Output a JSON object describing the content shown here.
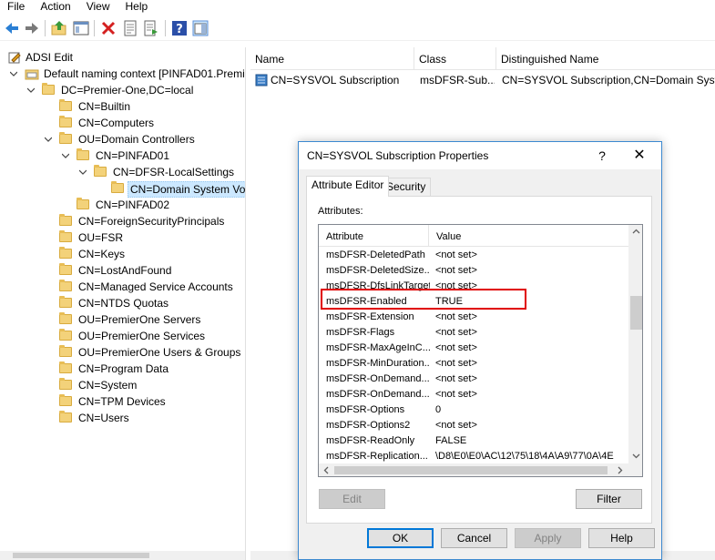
{
  "menu": {
    "items": [
      {
        "label": "File"
      },
      {
        "label": "Action"
      },
      {
        "label": "View"
      },
      {
        "label": "Help"
      }
    ]
  },
  "tree": {
    "root": "ADSI Edit",
    "nodes": [
      {
        "label": "Default naming context [PINFAD01.Premi"
      },
      {
        "label": "DC=Premier-One,DC=local"
      },
      {
        "label": "CN=Builtin"
      },
      {
        "label": "CN=Computers"
      },
      {
        "label": "OU=Domain Controllers"
      },
      {
        "label": "CN=PINFAD01"
      },
      {
        "label": "CN=DFSR-LocalSettings"
      },
      {
        "label": "CN=Domain System Vo"
      },
      {
        "label": "CN=PINFAD02"
      },
      {
        "label": "CN=ForeignSecurityPrincipals"
      },
      {
        "label": "OU=FSR"
      },
      {
        "label": "CN=Keys"
      },
      {
        "label": "CN=LostAndFound"
      },
      {
        "label": "CN=Managed Service Accounts"
      },
      {
        "label": "CN=NTDS Quotas"
      },
      {
        "label": "OU=PremierOne Servers"
      },
      {
        "label": "OU=PremierOne Services"
      },
      {
        "label": "OU=PremierOne Users & Groups"
      },
      {
        "label": "CN=Program Data"
      },
      {
        "label": "CN=System"
      },
      {
        "label": "CN=TPM Devices"
      },
      {
        "label": "CN=Users"
      }
    ]
  },
  "list": {
    "columns": {
      "name": "Name",
      "class": "Class",
      "dn": "Distinguished Name"
    },
    "rows": [
      {
        "name": "CN=SYSVOL Subscription",
        "class": "msDFSR-Sub...",
        "dn": "CN=SYSVOL Subscription,CN=Domain Syste"
      }
    ]
  },
  "dialog": {
    "title": "CN=SYSVOL Subscription Properties",
    "help_glyph": "?",
    "close_glyph": "✕",
    "tabs": [
      {
        "label": "Attribute Editor"
      },
      {
        "label": "Security"
      }
    ],
    "attributes_label": "Attributes:",
    "columns": {
      "attribute": "Attribute",
      "value": "Value"
    },
    "rows": [
      {
        "attribute": "msDFSR-DeletedPath",
        "value": "<not set>"
      },
      {
        "attribute": "msDFSR-DeletedSize...",
        "value": "<not set>"
      },
      {
        "attribute": "msDFSR-DfsLinkTarget",
        "value": "<not set>"
      },
      {
        "attribute": "msDFSR-Enabled",
        "value": "TRUE"
      },
      {
        "attribute": "msDFSR-Extension",
        "value": "<not set>"
      },
      {
        "attribute": "msDFSR-Flags",
        "value": "<not set>"
      },
      {
        "attribute": "msDFSR-MaxAgeInC...",
        "value": "<not set>"
      },
      {
        "attribute": "msDFSR-MinDuration...",
        "value": "<not set>"
      },
      {
        "attribute": "msDFSR-OnDemand...",
        "value": "<not set>"
      },
      {
        "attribute": "msDFSR-OnDemand...",
        "value": "<not set>"
      },
      {
        "attribute": "msDFSR-Options",
        "value": "0"
      },
      {
        "attribute": "msDFSR-Options2",
        "value": "<not set>"
      },
      {
        "attribute": "msDFSR-ReadOnly",
        "value": "FALSE"
      },
      {
        "attribute": "msDFSR-Replication...",
        "value": "\\D8\\E0\\E0\\AC\\12\\75\\18\\4A\\A9\\77\\0A\\4E"
      }
    ],
    "buttons": {
      "edit": "Edit",
      "filter": "Filter",
      "ok": "OK",
      "cancel": "Cancel",
      "apply": "Apply",
      "help": "Help"
    }
  },
  "colors": {
    "selection": "#cce8ff",
    "highlight": "#e00000",
    "dialog_border": "#3c89d0"
  }
}
